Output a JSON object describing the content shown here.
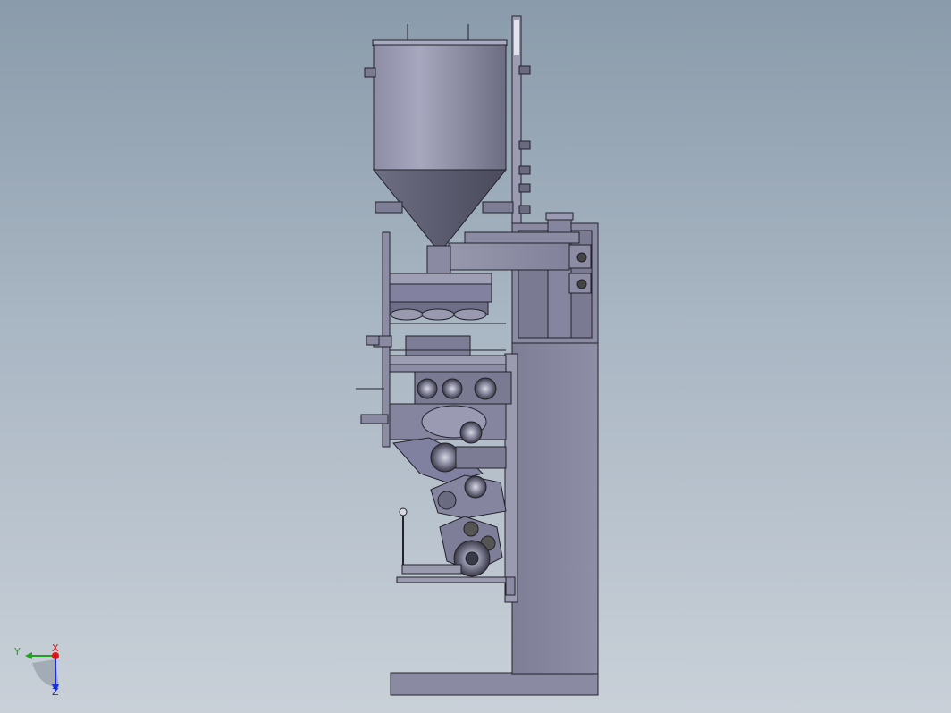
{
  "window": {
    "type": "cad-model-viewport"
  },
  "axis_triad": {
    "labels": {
      "y": "Y",
      "x": "X",
      "z": "Z"
    },
    "colors": {
      "y": "#1fa31f",
      "x": "#e01515",
      "z": "#1a2fd6"
    }
  },
  "colors": {
    "background_top": "#8a9bab",
    "background_bottom": "#c9d0d8",
    "metal": "#8c8ca4",
    "metal_dark": "#5a5a6e",
    "metal_light": "#c8c8d8",
    "outline": "#22222a"
  }
}
